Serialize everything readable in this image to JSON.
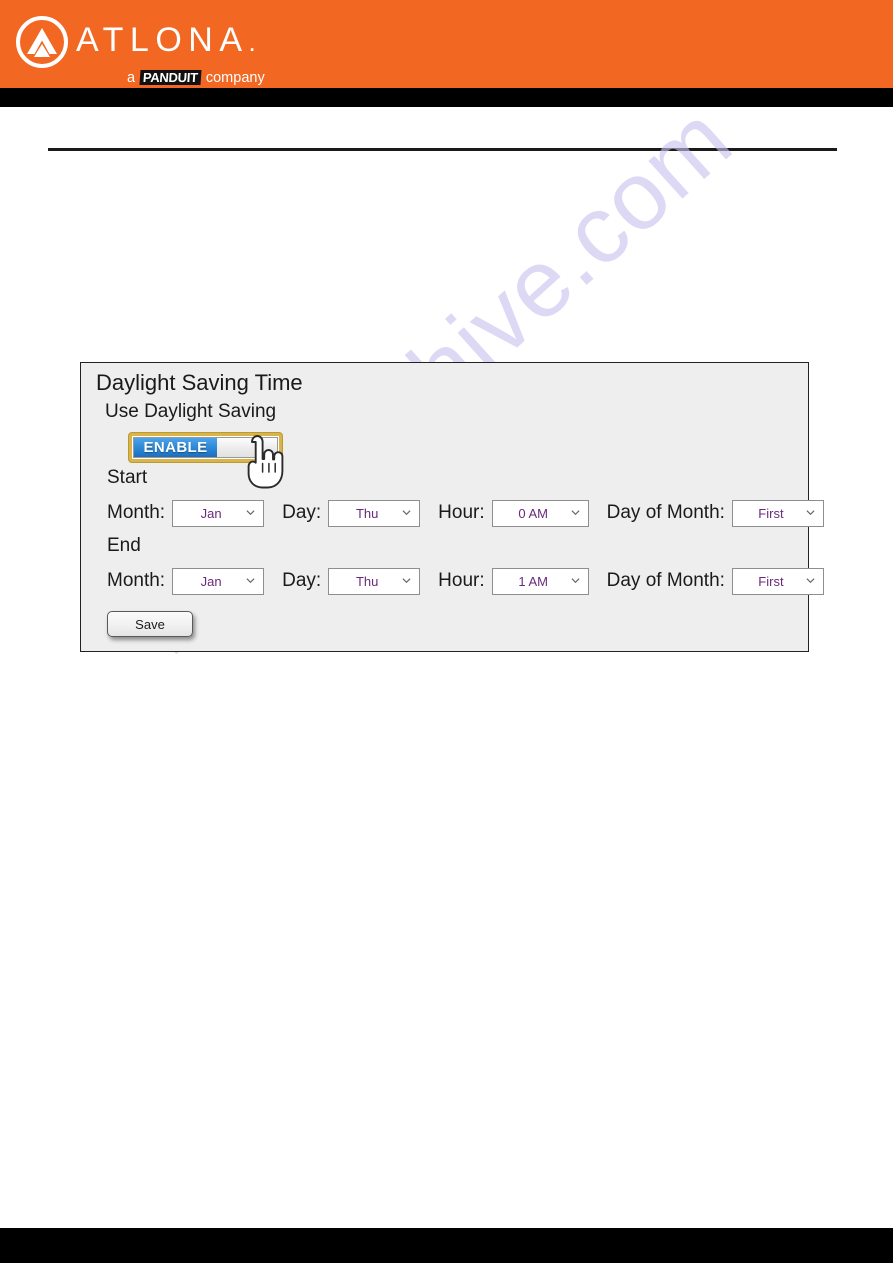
{
  "header": {
    "brand_name": "ATLONA",
    "brand_trademark": ".",
    "tagline_prefix": "a",
    "tagline_mark": "PANDUIT",
    "tagline_suffix": "company",
    "background_color": "#f26722",
    "logo_icon": "atlona-circle-chevron-logo"
  },
  "watermark": {
    "text": "manualshive.com",
    "color": "#c9c3ef"
  },
  "panel": {
    "title": "Daylight Saving Time",
    "use_dst_label": "Use Daylight Saving",
    "toggle": {
      "on_label": "ENABLE",
      "state": "enabled",
      "focus_border_color": "#d9b44a",
      "on_color": "#2f8ad8"
    },
    "start": {
      "section_label": "Start",
      "fields": [
        {
          "label": "Month:",
          "value": "Jan",
          "name": "start-month-select"
        },
        {
          "label": "Day:",
          "value": "Thu",
          "name": "start-day-select"
        },
        {
          "label": "Hour:",
          "value": "0 AM",
          "name": "start-hour-select"
        },
        {
          "label": "Day of Month:",
          "value": "First",
          "name": "start-day-of-month-select"
        }
      ]
    },
    "end": {
      "section_label": "End",
      "fields": [
        {
          "label": "Month:",
          "value": "Jan",
          "name": "end-month-select"
        },
        {
          "label": "Day:",
          "value": "Thu",
          "name": "end-day-select"
        },
        {
          "label": "Hour:",
          "value": "1 AM",
          "name": "end-hour-select"
        },
        {
          "label": "Day of Month:",
          "value": "First",
          "name": "end-day-of-month-select"
        }
      ]
    },
    "save_label": "Save"
  },
  "cursor": {
    "type": "pointing-hand-cursor"
  }
}
